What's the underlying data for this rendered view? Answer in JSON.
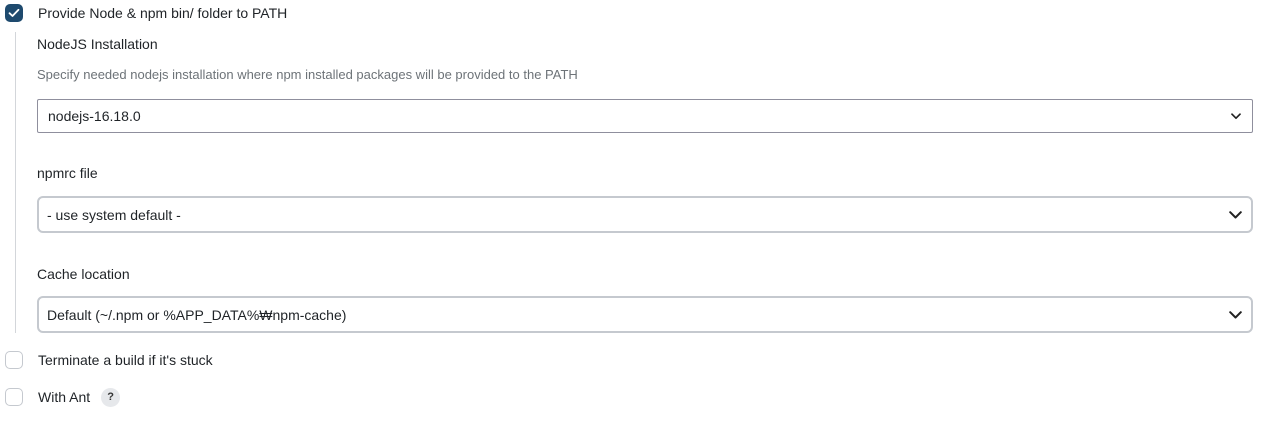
{
  "options": {
    "provide_path": {
      "label": "Provide Node & npm bin/ folder to PATH",
      "checked": true
    },
    "terminate_stuck": {
      "label": "Terminate a build if it's stuck",
      "checked": false
    },
    "with_ant": {
      "label": "With Ant",
      "checked": false,
      "help": "?"
    }
  },
  "nodejs": {
    "label": "NodeJS Installation",
    "description": "Specify needed nodejs installation where npm installed packages will be provided to the PATH",
    "selected": "nodejs-16.18.0"
  },
  "npmrc": {
    "label": "npmrc file",
    "selected": "- use system default -"
  },
  "cache": {
    "label": "Cache location",
    "selected": "Default (~/.npm or %APP_DATA%₩npm-cache)"
  },
  "colors": {
    "checked": "#1e4a6e",
    "border": "#c5c9cf",
    "muted_text": "#6d7378"
  }
}
